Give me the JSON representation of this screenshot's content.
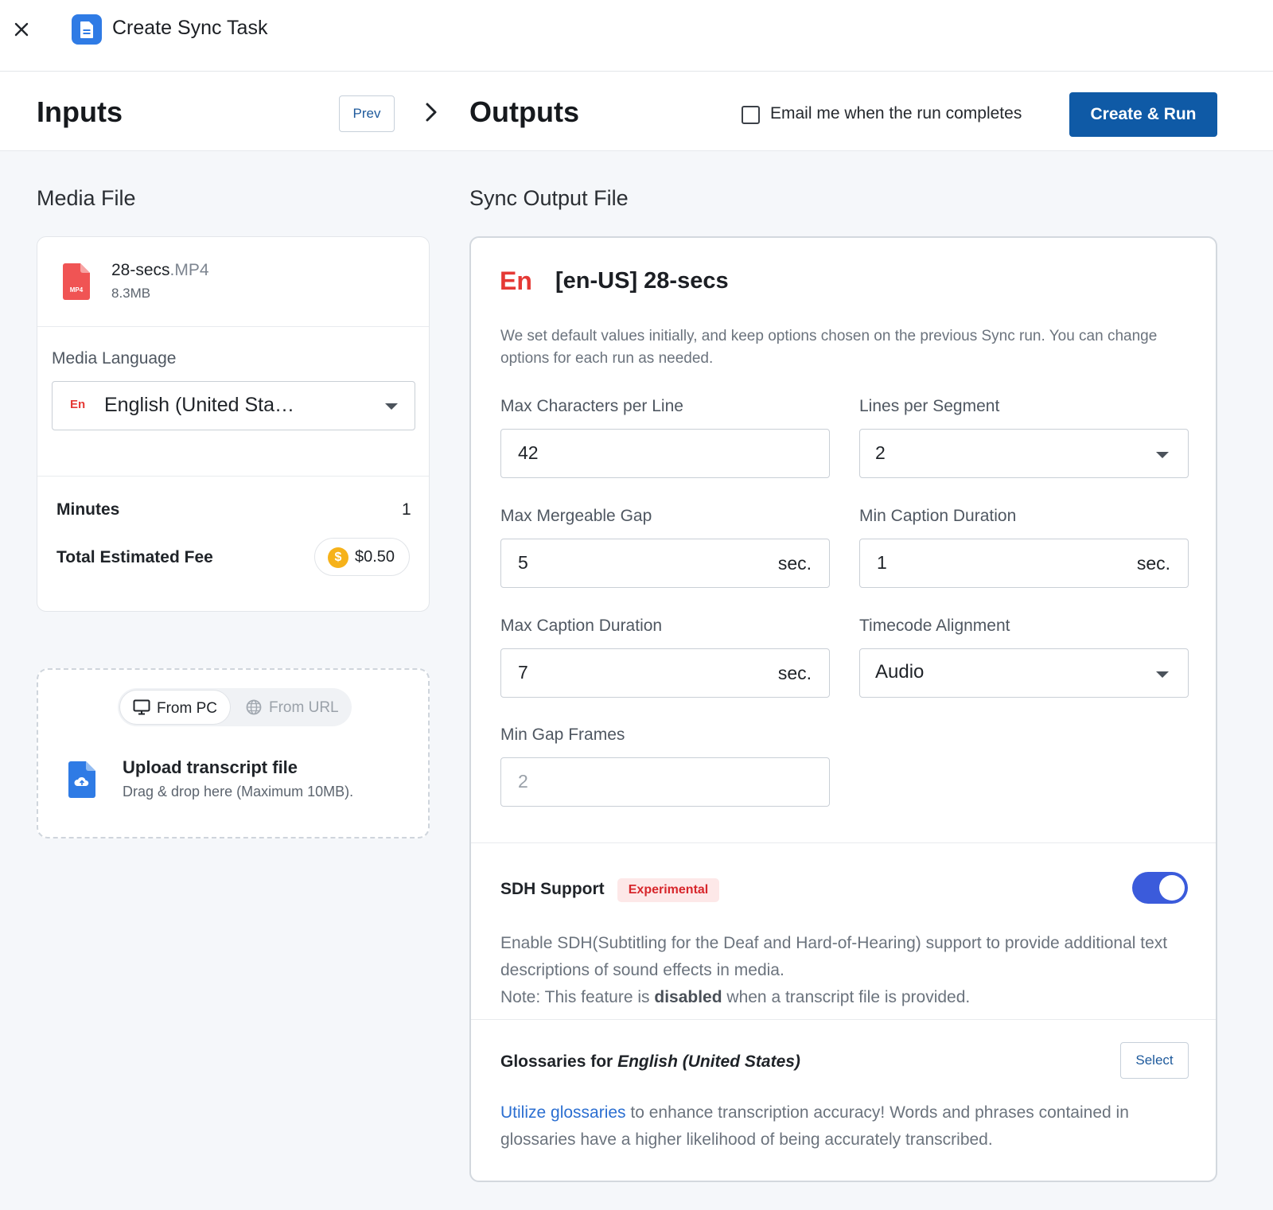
{
  "header": {
    "title": "Create Sync Task"
  },
  "steps": {
    "inputs_title": "Inputs",
    "prev_label": "Prev",
    "outputs_title": "Outputs",
    "email_label": "Email me when the run completes",
    "email_checked": false,
    "run_label": "Create & Run"
  },
  "media": {
    "section_title": "Media File",
    "file_name": "28-secs",
    "file_ext": ".MP4",
    "file_size": "8.3MB",
    "file_icon_label": "MP4",
    "language_label": "Media Language",
    "language_tag": "En",
    "language_value": "English (United Sta…",
    "minutes_label": "Minutes",
    "minutes_value": "1",
    "fee_label": "Total Estimated Fee",
    "fee_value": "$0.50"
  },
  "upload": {
    "tab_pc": "From PC",
    "tab_url": "From URL",
    "title": "Upload transcript file",
    "subtitle": "Drag & drop here (Maximum 10MB)."
  },
  "output": {
    "section_title": "Sync Output File",
    "lang_tag": "En",
    "name": "[en-US] 28-secs",
    "description": "We set default values initially, and keep options chosen on the previous Sync run. You can change options for each run as needed.",
    "max_chars_label": "Max Characters per Line",
    "max_chars_value": "42",
    "lines_label": "Lines per Segment",
    "lines_value": "2",
    "gap_label": "Max Mergeable Gap",
    "gap_value": "5",
    "min_dur_label": "Min Caption Duration",
    "min_dur_value": "1",
    "max_dur_label": "Max Caption Duration",
    "max_dur_value": "7",
    "align_label": "Timecode Alignment",
    "align_value": "Audio",
    "min_gap_label": "Min Gap Frames",
    "min_gap_value": "2",
    "unit": "sec.",
    "sdh_label": "SDH Support",
    "sdh_badge": "Experimental",
    "sdh_enabled": true,
    "sdh_desc_1": "Enable SDH(Subtitling for the Deaf and Hard-of-Hearing) support to provide additional text descriptions of sound effects in media.",
    "sdh_note_pre": "Note: This feature is ",
    "sdh_note_bold": "disabled",
    "sdh_note_post": " when a transcript file is provided.",
    "gloss_label_pre": "Glossaries for ",
    "gloss_lang": "English (United States)",
    "gloss_select": "Select",
    "gloss_link": "Utilize glossaries",
    "gloss_desc": " to enhance transcription accuracy! Words and phrases contained in glossaries have a higher likelihood of being accurately transcribed."
  },
  "colors": {
    "primary": "#0f5aa6",
    "accent_red": "#e53935",
    "toggle_on": "#3b5bdb",
    "link": "#2c6fd1",
    "coin": "#f6b21a"
  }
}
